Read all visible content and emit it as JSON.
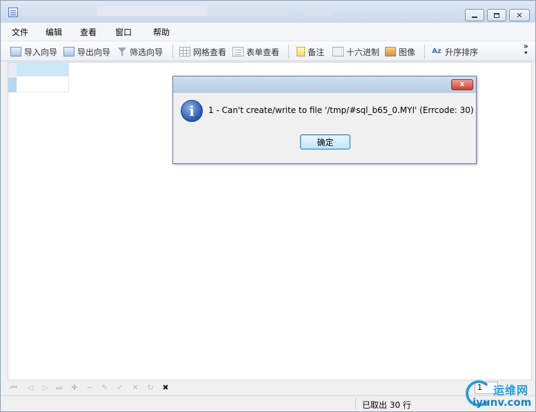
{
  "titlebar": {
    "controls": {
      "minimize": "minimize",
      "maximize": "maximize",
      "close": "close"
    }
  },
  "menu": {
    "items": [
      {
        "label": "文件"
      },
      {
        "label": "编辑"
      },
      {
        "label": "查看"
      },
      {
        "label": "窗口"
      },
      {
        "label": "帮助"
      }
    ]
  },
  "toolbar": {
    "buttons": [
      {
        "label": "导入向导",
        "icon": "import-wizard-icon"
      },
      {
        "label": "导出向导",
        "icon": "export-wizard-icon"
      },
      {
        "label": "筛选向导",
        "icon": "filter-icon"
      },
      {
        "label": "网格查看",
        "icon": "grid-view-icon"
      },
      {
        "label": "表单查看",
        "icon": "form-view-icon"
      },
      {
        "label": "备注",
        "icon": "note-icon"
      },
      {
        "label": "十六进制",
        "icon": "hex-icon"
      },
      {
        "label": "图像",
        "icon": "image-icon"
      },
      {
        "label": "升序排序",
        "icon": "sort-ascending-icon"
      }
    ],
    "overflow": "»"
  },
  "dialog": {
    "message": "1 - Can't create/write to file '/tmp/#sql_b65_0.MYI' (Errcode: 30)",
    "ok_label": "确定",
    "info_glyph": "i",
    "close_glyph": "x"
  },
  "navigation": {
    "page_value": "1",
    "stop_glyph": "✖"
  },
  "status": {
    "rows_fetched": "已取出 30 行"
  },
  "watermark": {
    "cn": "运维网",
    "en": "iyunv.com"
  },
  "colors": {
    "accent": "#2a9bd8",
    "dialog_border": "#5d7fa6",
    "ok_border": "#3c7fb1",
    "close_red": "#c9442f"
  }
}
